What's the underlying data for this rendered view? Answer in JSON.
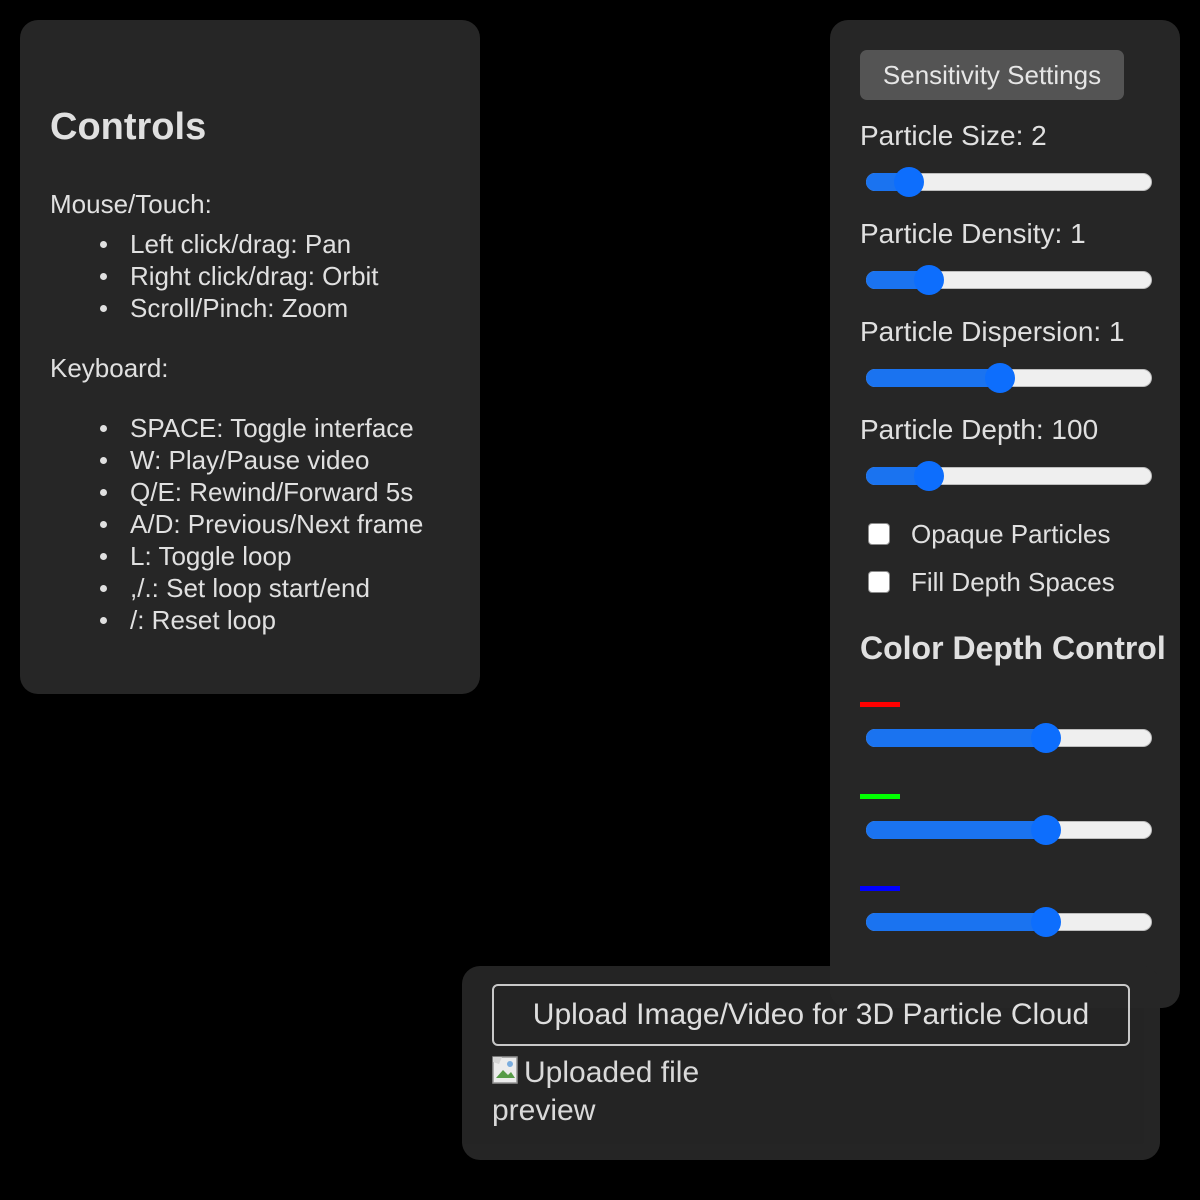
{
  "controls": {
    "title": "Controls",
    "mouse_section": "Mouse/Touch:",
    "mouse_items": [
      "Left click/drag: Pan",
      "Right click/drag: Orbit",
      "Scroll/Pinch: Zoom"
    ],
    "keyboard_section": "Keyboard:",
    "keyboard_items": [
      "SPACE: Toggle interface",
      "W: Play/Pause video",
      "Q/E: Rewind/Forward 5s",
      "A/D: Previous/Next frame",
      "L: Toggle loop",
      ",/.: Set loop start/end",
      "/: Reset loop"
    ]
  },
  "settings": {
    "sensitivity_button": "Sensitivity Settings",
    "sliders": [
      {
        "label": "Particle Size: 2",
        "level": 0.15
      },
      {
        "label": "Particle Density: 1",
        "level": 0.22
      },
      {
        "label": "Particle Dispersion: 1",
        "level": 0.47
      },
      {
        "label": "Particle Depth: 100",
        "level": 0.22
      }
    ],
    "checkboxes": [
      {
        "label": "Opaque Particles",
        "checked": false
      },
      {
        "label": "Fill Depth Spaces",
        "checked": false
      }
    ],
    "color_depth_title": "Color Depth Control",
    "color_sliders": [
      {
        "color": "#ff0000",
        "level": 0.63
      },
      {
        "color": "#00ff00",
        "level": 0.63
      },
      {
        "color": "#0000ff",
        "level": 0.63
      }
    ]
  },
  "upload": {
    "button_label": "Upload Image/Video for 3D Particle Cloud",
    "preview_alt": "Uploaded file preview",
    "preview_icon": "broken-image-icon"
  },
  "colors": {
    "background": "#000000",
    "panel": "#262626",
    "accent": "#0d6efd"
  }
}
